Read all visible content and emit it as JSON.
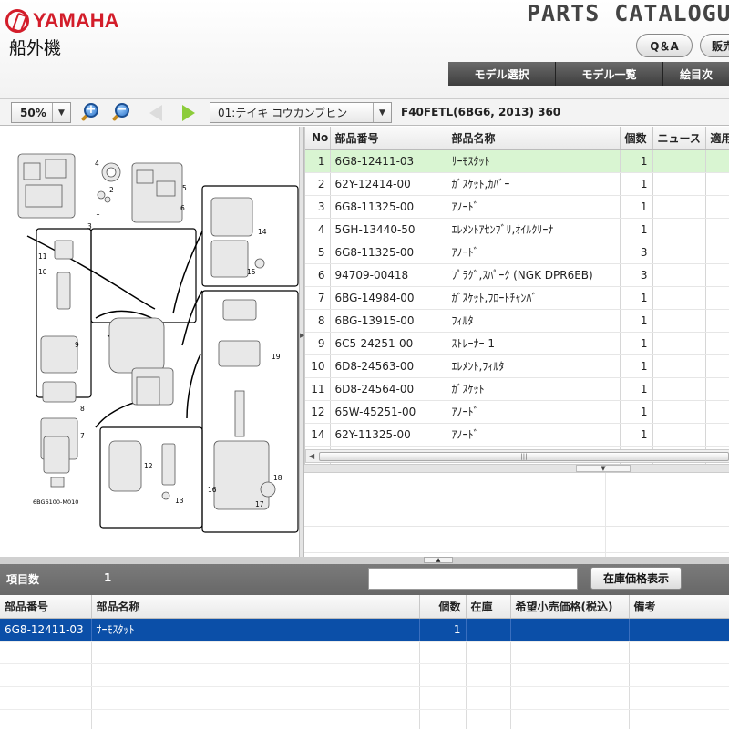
{
  "header": {
    "brand": "YAMAHA",
    "subtitle": "船外機",
    "catalog_title": "PARTS CATALOGUE",
    "buttons": {
      "qa": "Q＆A",
      "sales": "販売"
    },
    "nav": [
      "モデル選択",
      "モデル一覧",
      "絵目次"
    ]
  },
  "toolbar": {
    "zoom": "50%",
    "section": "01:テイキ コウカンブヒン",
    "model_info": "F40FETL(6BG6, 2013) 360"
  },
  "diagram": {
    "code": "6BG6100-M010",
    "callouts": [
      "1",
      "2",
      "3",
      "4",
      "5",
      "6",
      "7",
      "8",
      "9",
      "10",
      "11",
      "12",
      "13",
      "14",
      "15",
      "16",
      "17",
      "18",
      "19"
    ]
  },
  "parts_table": {
    "columns": [
      "No",
      "部品番号",
      "部品名称",
      "個数",
      "ニュース",
      "適用"
    ],
    "rows": [
      {
        "no": "1",
        "part": "6G8-12411-03",
        "name": "ｻｰﾓｽﾀｯﾄ",
        "qty": "1"
      },
      {
        "no": "2",
        "part": "62Y-12414-00",
        "name": "ｶﾞｽｹｯﾄ,ｶﾊﾞｰ",
        "qty": "1"
      },
      {
        "no": "3",
        "part": "6G8-11325-00",
        "name": "ｱﾉｰﾄﾞ",
        "qty": "1"
      },
      {
        "no": "4",
        "part": "5GH-13440-50",
        "name": "ｴﾚﾒﾝﾄｱｾﾝﾌﾞﾘ,ｵｲﾙｸﾘｰﾅ",
        "qty": "1"
      },
      {
        "no": "5",
        "part": "6G8-11325-00",
        "name": "ｱﾉｰﾄﾞ",
        "qty": "3"
      },
      {
        "no": "6",
        "part": "94709-00418",
        "name": "ﾌﾟﾗｸﾞ,ｽﾊﾟｰｸ (NGK DPR6EB)",
        "qty": "3"
      },
      {
        "no": "7",
        "part": "6BG-14984-00",
        "name": "ｶﾞｽｹｯﾄ,ﾌﾛｰﾄﾁｬﾝﾊﾞ",
        "qty": "1"
      },
      {
        "no": "8",
        "part": "6BG-13915-00",
        "name": "ﾌｨﾙﾀ",
        "qty": "1"
      },
      {
        "no": "9",
        "part": "6C5-24251-00",
        "name": "ｽﾄﾚｰﾅｰ 1",
        "qty": "1"
      },
      {
        "no": "10",
        "part": "6D8-24563-00",
        "name": "ｴﾚﾒﾝﾄ,ﾌｨﾙﾀ",
        "qty": "1"
      },
      {
        "no": "11",
        "part": "6D8-24564-00",
        "name": "ｶﾞｽｹｯﾄ",
        "qty": "1"
      },
      {
        "no": "12",
        "part": "65W-45251-00",
        "name": "ｱﾉｰﾄﾞ",
        "qty": "1"
      },
      {
        "no": "14",
        "part": "62Y-11325-00",
        "name": "ｱﾉｰﾄﾞ",
        "qty": "1"
      }
    ]
  },
  "info_bar": {
    "count_label": "項目数",
    "count": "1",
    "stock_button": "在庫価格表示"
  },
  "cart_table": {
    "columns": [
      "部品番号",
      "部品名称",
      "個数",
      "在庫",
      "希望小売価格(税込)",
      "備考"
    ],
    "rows": [
      {
        "part": "6G8-12411-03",
        "name": "ｻｰﾓｽﾀｯﾄ",
        "qty": "1",
        "stock": "",
        "price": "",
        "note": ""
      }
    ]
  },
  "colors": {
    "brand": "#d31d2a",
    "selected_row": "#d9f5d2",
    "cart_selected": "#0b4fa8",
    "nav_bg": "#4a4a4a"
  }
}
